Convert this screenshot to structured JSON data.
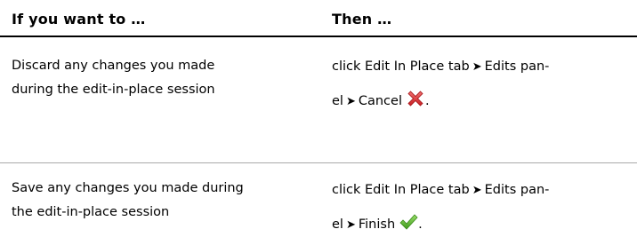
{
  "table": {
    "header": {
      "condition": "If you want to …",
      "action": "Then …"
    },
    "rows": [
      {
        "condition_lines": [
          "Discard any changes you made",
          "during the edit-in-place session"
        ],
        "action_line1_pre": "click Edit In Place tab",
        "arrow": "➤",
        "action_line1_post": "Edits pan-",
        "action_line2_pre": "el",
        "action_line2_post": "Cancel",
        "action_line2_end": ".",
        "icon": "cancel-x-icon",
        "icon_color": "#d9262a"
      },
      {
        "condition_lines": [
          "Save any changes you made during",
          "the edit-in-place session"
        ],
        "action_line1_pre": "click Edit In Place tab",
        "arrow": "➤",
        "action_line1_post": "Edits pan-",
        "action_line2_pre": "el",
        "action_line2_post": "Finish",
        "action_line2_end": ".",
        "icon": "finish-check-icon",
        "icon_color": "#5cb82e"
      }
    ]
  }
}
